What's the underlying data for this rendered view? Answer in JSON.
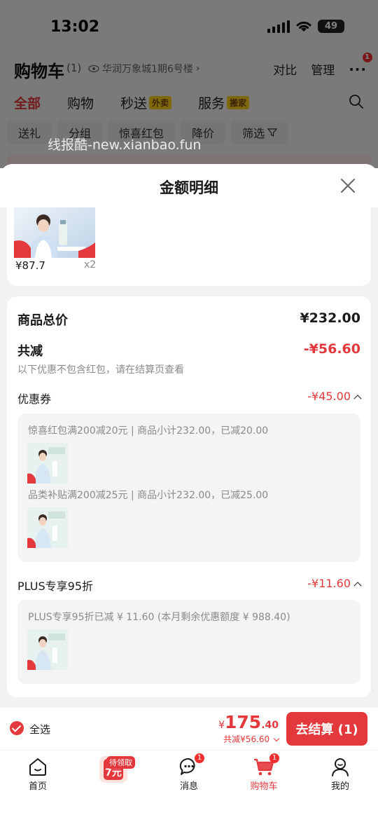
{
  "status": {
    "time": "13:02",
    "battery": "49"
  },
  "cart_page": {
    "title": "购物车",
    "count": "(1)",
    "location": "华润万象城1期6号楼",
    "compare": "对比",
    "manage": "管理",
    "more_badge": "1",
    "tabs": [
      {
        "label": "全部"
      },
      {
        "label": "购物"
      },
      {
        "label": "秒送",
        "tag": "外卖"
      },
      {
        "label": "服务",
        "tag": "搬家"
      }
    ],
    "filters": [
      "送礼",
      "分组",
      "惊喜红包",
      "降价",
      "筛选"
    ],
    "watermark": "线报酷-new.xianbao.fun"
  },
  "sheet": {
    "title": "金额明细",
    "item": {
      "price": "¥87.7",
      "qty": "x2"
    },
    "total_label": "商品总价",
    "total_value": "¥232.00",
    "reduce_label": "共减",
    "reduce_value": "-¥56.60",
    "note": "以下优惠不包含红包，请在结算页查看",
    "coupon_label": "优惠券",
    "coupon_value": "-¥45.00",
    "coupon_lines": [
      "惊喜红包满200减20元 | 商品小计232.00，已减20.00",
      "品类补贴满200减25元 | 商品小计232.00，已减25.00"
    ],
    "plus_label": "PLUS专享95折",
    "plus_value": "-¥11.60",
    "plus_line": "PLUS专享95折已减 ¥ 11.60 (本月剩余优惠额度 ¥ 988.40)"
  },
  "checkout": {
    "select_all": "全选",
    "currency": "¥",
    "price_int": "175",
    "price_dec": ".40",
    "saved": "共减¥56.60",
    "button": "去结算 (1)"
  },
  "tabbar": {
    "reward_tag": "待领取",
    "items": [
      {
        "label": "首页"
      },
      {
        "label": ""
      },
      {
        "label": "消息",
        "badge": "1"
      },
      {
        "label": "购物车",
        "badge": "1"
      },
      {
        "label": "我的"
      }
    ]
  },
  "colors": {
    "accent": "#e4393c",
    "sheet_bg": "#f2f2f2",
    "subbox_bg": "#f4f4f4"
  }
}
